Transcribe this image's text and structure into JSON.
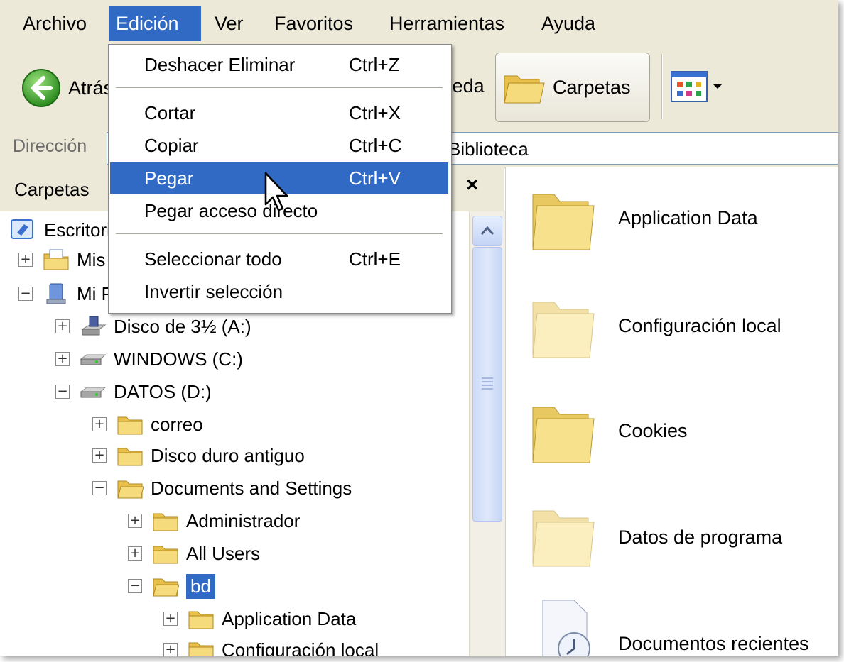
{
  "menubar": {
    "items": [
      "Archivo",
      "Edición",
      "Ver",
      "Favoritos",
      "Herramientas",
      "Ayuda"
    ],
    "active": "Edición"
  },
  "toolbar": {
    "back_label": "Atrás",
    "search_label": "Búsqueda",
    "folders_label": "Carpetas",
    "views_icon": "views-icon"
  },
  "address": {
    "label": "Dirección",
    "value": "Biblioteca"
  },
  "edit_menu": {
    "items": [
      {
        "label": "Deshacer Eliminar",
        "shortcut": "Ctrl+Z"
      },
      {
        "label": "Cortar",
        "shortcut": "Ctrl+X"
      },
      {
        "label": "Copiar",
        "shortcut": "Ctrl+C"
      },
      {
        "label": "Pegar",
        "shortcut": "Ctrl+V"
      },
      {
        "label": "Pegar acceso directo",
        "shortcut": ""
      },
      {
        "label": "Seleccionar todo",
        "shortcut": "Ctrl+E"
      },
      {
        "label": "Invertir selección",
        "shortcut": ""
      }
    ],
    "highlighted": "Pegar"
  },
  "folders_pane": {
    "title": "Carpetas",
    "close": "×",
    "tree": [
      {
        "label": "Escritorio",
        "expander": ""
      },
      {
        "label": "Mis documentos",
        "expander": "+"
      },
      {
        "label": "Mi PC",
        "expander": "−"
      },
      {
        "label": "Disco de 3½ (A:)",
        "expander": "+"
      },
      {
        "label": "WINDOWS (C:)",
        "expander": "+"
      },
      {
        "label": "DATOS (D:)",
        "expander": "−"
      },
      {
        "label": "correo",
        "expander": "+"
      },
      {
        "label": "Disco duro antiguo",
        "expander": "+"
      },
      {
        "label": "Documents and Settings",
        "expander": "−"
      },
      {
        "label": "Administrador",
        "expander": "+"
      },
      {
        "label": "All Users",
        "expander": "+"
      },
      {
        "label": "bd",
        "expander": "−"
      },
      {
        "label": "Application Data",
        "expander": "+"
      },
      {
        "label": "Configuración local",
        "expander": "+"
      }
    ],
    "selected": "bd"
  },
  "content": {
    "items": [
      "Application Data",
      "Configuración local",
      "Cookies",
      "Datos de programa",
      "Documentos recientes"
    ]
  },
  "colors": {
    "selection": "#316ac5",
    "chrome": "#ece9d8",
    "folder": "#f4d77a"
  }
}
